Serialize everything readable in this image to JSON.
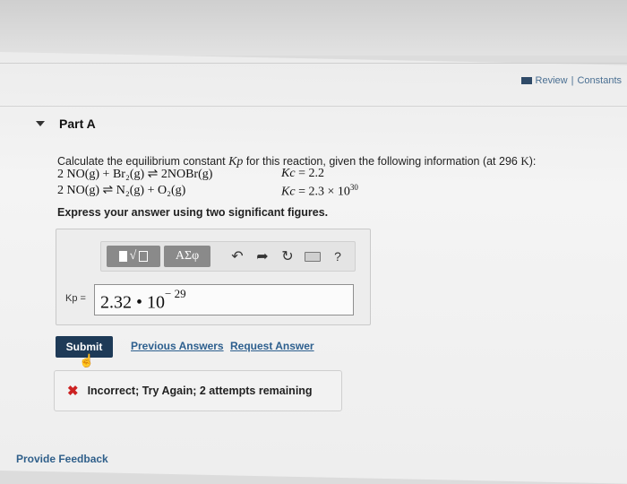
{
  "header": {
    "review_label": "Review",
    "separator": "|",
    "constants_label": "Constants"
  },
  "part": {
    "title": "Part A"
  },
  "question": {
    "prefix": "Calculate the equilibrium constant",
    "kp_symbol": "Kp",
    "middle": "for this reaction, given the following information (at 296",
    "unit": "K",
    "suffix": "):"
  },
  "reactions": [
    {
      "equation": "2 NO(g) + Br₂(g) ⇌ 2NOBr(g)",
      "k_symbol": "Kc",
      "k_value": "= 2.2"
    },
    {
      "equation": "2 NO(g) ⇌ N₂(g) + O₂(g)",
      "k_symbol": "Kc",
      "k_value": "= 2.3 × 10",
      "k_exponent": "30"
    }
  ],
  "instruction": "Express your answer using two significant figures.",
  "toolbar": {
    "templates_label": "√",
    "symbols_label": "ΑΣφ",
    "undo_icon": "undo-icon",
    "redo_icon": "redo-icon",
    "reset_icon": "reset-icon",
    "keyboard_icon": "keyboard-icon",
    "help_label": "?"
  },
  "answer": {
    "label": "Kp =",
    "mantissa": "2.32 • 10",
    "exponent": "− 29"
  },
  "actions": {
    "submit_label": "Submit",
    "previous_answers_label": "Previous Answers",
    "request_answer_label": "Request Answer"
  },
  "feedback": {
    "message": "Incorrect; Try Again; 2 attempts remaining"
  },
  "footer": {
    "provide_feedback_label": "Provide Feedback"
  },
  "colors": {
    "submit_bg": "#1e3a57",
    "link": "#2d5f8e",
    "error": "#cc2222"
  }
}
